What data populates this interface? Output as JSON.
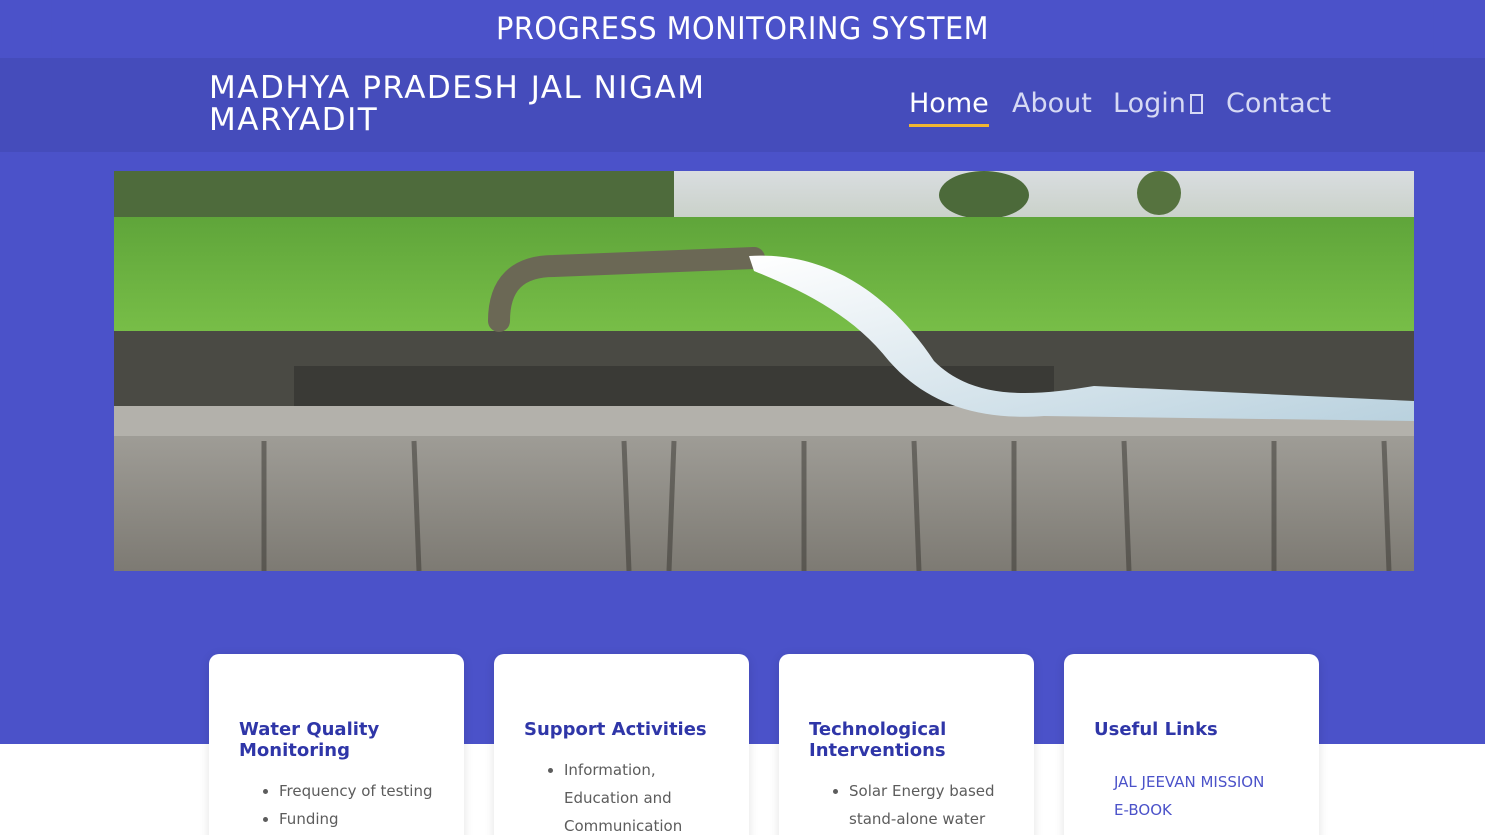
{
  "site": {
    "top_title": "PROGRESS MONITORING SYSTEM",
    "brand": "MADHYA PRADESH JAL NIGAM MARYADIT"
  },
  "nav": {
    "items": [
      {
        "label": "Home",
        "active": true
      },
      {
        "label": "About"
      },
      {
        "label": "Login"
      },
      {
        "label": "Contact"
      }
    ]
  },
  "hero": {
    "image": "water-pump-field-photo"
  },
  "cards": [
    {
      "title": "Water Quality Monitoring",
      "items": [
        "Frequency of testing",
        "Funding"
      ]
    },
    {
      "title": "Support Activities",
      "items": [
        "Information, Education and Communication (IEC)"
      ]
    },
    {
      "title": "Technological Interventions",
      "items": [
        "Solar Energy based stand-alone water"
      ]
    },
    {
      "title": "Useful Links",
      "links": [
        "JAL JEEVAN MISSION",
        "E-BOOK"
      ]
    }
  ],
  "colors": {
    "primary": "#4b52c9",
    "navbar": "#454cbb",
    "accent": "#f0b632",
    "card_title": "#2f36a8"
  }
}
